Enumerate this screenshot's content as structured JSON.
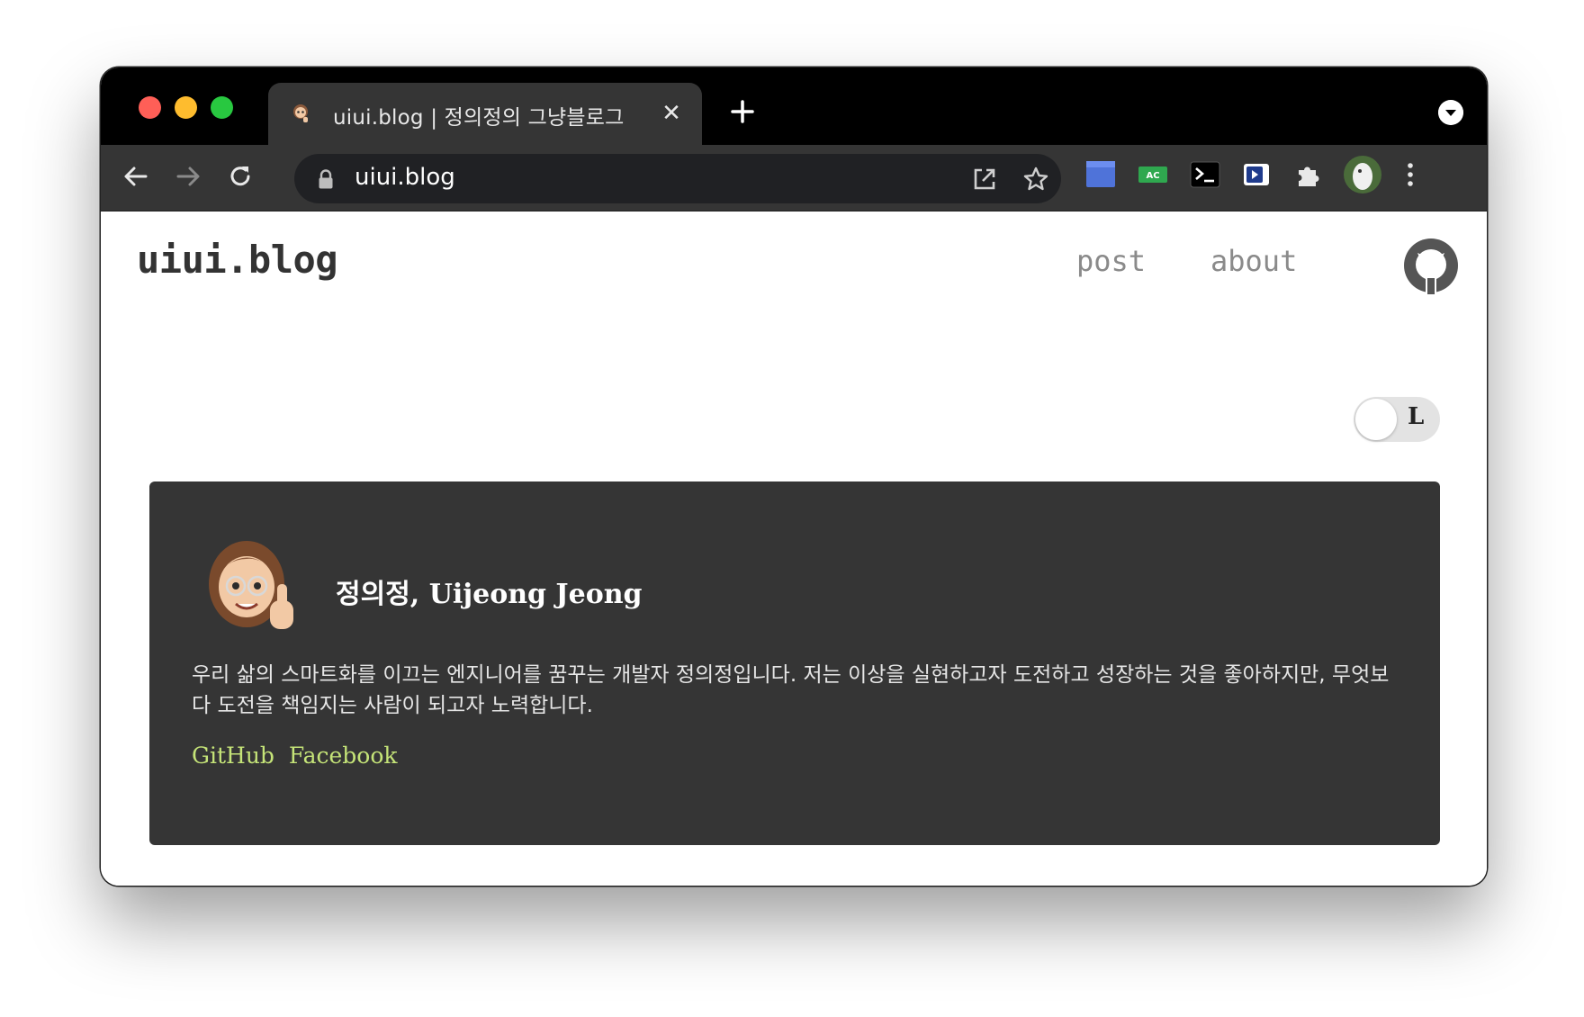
{
  "browser": {
    "tab_title": "uiui.blog | 정의정의 그냥블로그",
    "url": "uiui.blog",
    "new_tab_label": "+"
  },
  "site": {
    "logo": "uiui.blog",
    "nav": [
      "post",
      "about"
    ],
    "toggle_label": "L"
  },
  "profile": {
    "name": "정의정, Uijeong Jeong",
    "bio": "우리 삶의 스마트화를 이끄는 엔지니어를 꿈꾸는 개발자 정의정입니다. 저는 이상을 실현하고자 도전하고 성장하는 것을 좋아하지만, 무엇보다 도전을 책임지는 사람이 되고자 노력합니다.",
    "links": [
      "GitHub",
      "Facebook"
    ]
  },
  "colors": {
    "card_bg": "#353535",
    "link": "#c5e478",
    "titlebar": "#000000",
    "toolbar": "#353535"
  }
}
